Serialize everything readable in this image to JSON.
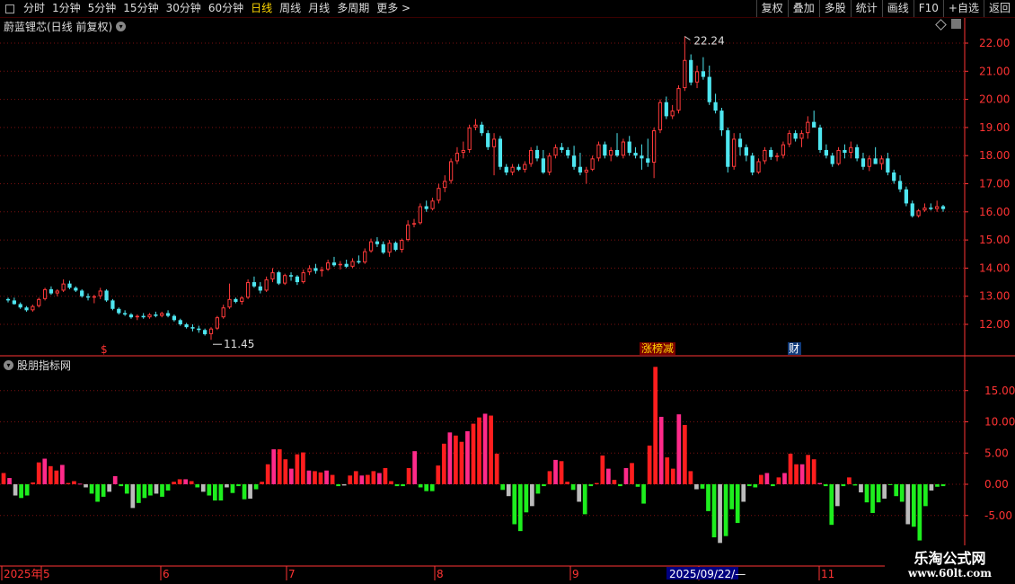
{
  "toolbar": {
    "periods": [
      "分时",
      "1分钟",
      "5分钟",
      "15分钟",
      "30分钟",
      "60分钟",
      "日线",
      "周线",
      "月线",
      "多周期",
      "更多 >"
    ],
    "active_period": "日线",
    "right_buttons": [
      "复权",
      "叠加",
      "多股",
      "统计",
      "画线",
      "F10",
      "+自选",
      "返回"
    ]
  },
  "chart": {
    "title": "蔚蓝锂芯(日线 前复权)",
    "high_label": "22.24",
    "low_label": "11.45",
    "price_axis": [
      "22.00",
      "21.00",
      "20.00",
      "19.00",
      "18.00",
      "17.00",
      "16.00",
      "15.00",
      "14.00",
      "13.00",
      "12.00"
    ],
    "markers": {
      "s": "$",
      "zbj": "涨榜减",
      "cai": "财"
    }
  },
  "indicator": {
    "title": "股朋指标网",
    "axis": [
      "15.00",
      "10.00",
      "5.00",
      "0.00",
      "-5.00"
    ]
  },
  "time_axis": {
    "labels": [
      "2025年",
      "5",
      "6",
      "7",
      "8",
      "9",
      "10",
      "11"
    ],
    "cursor_date": "2025/09/22/—"
  },
  "watermark": {
    "line1": "乐淘公式网",
    "line2": "www.60lt.com"
  },
  "colors": {
    "up": "#ff3a3a",
    "down": "#4ee6f0",
    "ind_red": "#ff1e1e",
    "ind_pink": "#ff2a8a",
    "ind_green": "#1eee1e",
    "ind_gray": "#bbbbbb",
    "axis": "#ff3333"
  },
  "chart_data": [
    {
      "type": "candlestick",
      "title": "蔚蓝锂芯(日线 前复权)",
      "ylim": [
        11.1,
        22.6
      ],
      "ohlc": [
        [
          12.9,
          12.95,
          12.78,
          12.85
        ],
        [
          12.85,
          12.95,
          12.7,
          12.72
        ],
        [
          12.72,
          12.78,
          12.55,
          12.6
        ],
        [
          12.6,
          12.65,
          12.45,
          12.5
        ],
        [
          12.5,
          12.7,
          12.45,
          12.65
        ],
        [
          12.65,
          12.95,
          12.6,
          12.9
        ],
        [
          12.9,
          13.3,
          12.85,
          13.25
        ],
        [
          13.25,
          13.35,
          13.05,
          13.1
        ],
        [
          13.1,
          13.25,
          13.0,
          13.2
        ],
        [
          13.2,
          13.6,
          13.15,
          13.45
        ],
        [
          13.45,
          13.55,
          13.25,
          13.3
        ],
        [
          13.3,
          13.35,
          13.15,
          13.2
        ],
        [
          13.2,
          13.25,
          12.95,
          13.0
        ],
        [
          13.0,
          13.1,
          12.85,
          12.95
        ],
        [
          12.95,
          13.05,
          12.75,
          13.0
        ],
        [
          13.0,
          13.3,
          12.9,
          13.2
        ],
        [
          13.2,
          13.25,
          12.8,
          12.85
        ],
        [
          12.85,
          12.9,
          12.5,
          12.55
        ],
        [
          12.55,
          12.6,
          12.35,
          12.4
        ],
        [
          12.4,
          12.5,
          12.3,
          12.35
        ],
        [
          12.35,
          12.4,
          12.2,
          12.25
        ],
        [
          12.25,
          12.35,
          12.15,
          12.3
        ],
        [
          12.3,
          12.4,
          12.2,
          12.25
        ],
        [
          12.25,
          12.4,
          12.2,
          12.35
        ],
        [
          12.35,
          12.45,
          12.25,
          12.3
        ],
        [
          12.3,
          12.45,
          12.25,
          12.4
        ],
        [
          12.4,
          12.5,
          12.25,
          12.3
        ],
        [
          12.3,
          12.35,
          12.1,
          12.15
        ],
        [
          12.15,
          12.2,
          11.95,
          12.0
        ],
        [
          12.0,
          12.05,
          11.85,
          11.9
        ],
        [
          11.9,
          12.0,
          11.75,
          11.85
        ],
        [
          11.85,
          11.95,
          11.7,
          11.8
        ],
        [
          11.8,
          11.85,
          11.6,
          11.65
        ],
        [
          11.65,
          11.9,
          11.45,
          11.85
        ],
        [
          11.85,
          12.3,
          11.8,
          12.25
        ],
        [
          12.25,
          12.7,
          12.2,
          12.6
        ],
        [
          12.6,
          13.45,
          12.55,
          12.9
        ],
        [
          12.9,
          12.95,
          12.75,
          12.8
        ],
        [
          12.8,
          13.0,
          12.7,
          12.95
        ],
        [
          12.95,
          13.6,
          12.9,
          13.5
        ],
        [
          13.5,
          13.7,
          13.3,
          13.35
        ],
        [
          13.35,
          13.5,
          13.1,
          13.2
        ],
        [
          13.2,
          13.7,
          13.15,
          13.6
        ],
        [
          13.6,
          14.0,
          13.5,
          13.85
        ],
        [
          13.85,
          13.9,
          13.4,
          13.45
        ],
        [
          13.45,
          13.8,
          13.4,
          13.75
        ],
        [
          13.75,
          13.85,
          13.55,
          13.7
        ],
        [
          13.7,
          13.75,
          13.4,
          13.5
        ],
        [
          13.5,
          13.95,
          13.45,
          13.85
        ],
        [
          13.85,
          14.1,
          13.75,
          14.0
        ],
        [
          14.0,
          14.15,
          13.8,
          13.9
        ],
        [
          13.9,
          14.05,
          13.7,
          13.95
        ],
        [
          13.95,
          14.3,
          13.9,
          14.2
        ],
        [
          14.2,
          14.4,
          14.05,
          14.1
        ],
        [
          14.1,
          14.25,
          13.95,
          14.15
        ],
        [
          14.15,
          14.3,
          14.0,
          14.05
        ],
        [
          14.05,
          14.35,
          14.0,
          14.25
        ],
        [
          14.25,
          14.45,
          14.15,
          14.2
        ],
        [
          14.2,
          14.7,
          14.15,
          14.6
        ],
        [
          14.6,
          15.05,
          14.55,
          14.95
        ],
        [
          14.95,
          15.1,
          14.75,
          14.85
        ],
        [
          14.85,
          14.95,
          14.5,
          14.55
        ],
        [
          14.55,
          15.0,
          14.4,
          14.9
        ],
        [
          14.9,
          14.95,
          14.6,
          14.65
        ],
        [
          14.65,
          15.05,
          14.55,
          15.0
        ],
        [
          15.0,
          15.7,
          14.95,
          15.55
        ],
        [
          15.55,
          15.75,
          15.45,
          15.6
        ],
        [
          15.6,
          16.3,
          15.55,
          16.2
        ],
        [
          16.2,
          16.4,
          16.0,
          16.1
        ],
        [
          16.1,
          16.5,
          16.05,
          16.4
        ],
        [
          16.4,
          17.0,
          16.3,
          16.85
        ],
        [
          16.85,
          17.3,
          16.7,
          17.1
        ],
        [
          17.1,
          17.9,
          17.0,
          17.8
        ],
        [
          17.8,
          18.3,
          17.7,
          18.1
        ],
        [
          18.1,
          18.5,
          17.9,
          18.2
        ],
        [
          18.2,
          19.1,
          18.1,
          19.0
        ],
        [
          19.0,
          19.3,
          18.9,
          19.1
        ],
        [
          19.1,
          19.2,
          18.7,
          18.8
        ],
        [
          18.8,
          18.9,
          18.2,
          18.3
        ],
        [
          18.3,
          18.8,
          17.3,
          18.6
        ],
        [
          18.6,
          18.7,
          17.5,
          17.6
        ],
        [
          17.6,
          17.7,
          17.3,
          17.4
        ],
        [
          17.4,
          17.7,
          17.3,
          17.6
        ],
        [
          17.6,
          17.7,
          17.45,
          17.5
        ],
        [
          17.5,
          17.8,
          17.4,
          17.7
        ],
        [
          17.7,
          18.3,
          17.6,
          18.2
        ],
        [
          18.2,
          18.35,
          17.8,
          17.9
        ],
        [
          17.9,
          18.2,
          17.35,
          17.4
        ],
        [
          17.4,
          18.1,
          17.3,
          18.0
        ],
        [
          18.0,
          18.4,
          17.9,
          18.3
        ],
        [
          18.3,
          18.45,
          18.1,
          18.2
        ],
        [
          18.2,
          18.3,
          17.9,
          18.0
        ],
        [
          18.0,
          18.35,
          17.5,
          17.6
        ],
        [
          17.6,
          18.1,
          17.3,
          17.4
        ],
        [
          17.4,
          17.6,
          17.0,
          17.5
        ],
        [
          17.5,
          18.0,
          17.45,
          17.9
        ],
        [
          17.9,
          18.5,
          17.8,
          18.4
        ],
        [
          18.4,
          18.5,
          17.9,
          18.0
        ],
        [
          18.0,
          18.3,
          17.8,
          18.2
        ],
        [
          18.2,
          18.8,
          17.95,
          18.0
        ],
        [
          18.0,
          18.6,
          17.9,
          18.5
        ],
        [
          18.5,
          18.7,
          18.0,
          18.1
        ],
        [
          18.1,
          18.3,
          17.9,
          18.0
        ],
        [
          18.0,
          18.4,
          17.5,
          17.9
        ],
        [
          17.9,
          18.6,
          17.6,
          17.75
        ],
        [
          17.75,
          19.0,
          17.2,
          18.9
        ],
        [
          18.9,
          20.0,
          18.8,
          19.9
        ],
        [
          19.9,
          20.1,
          19.3,
          19.4
        ],
        [
          19.4,
          19.8,
          19.3,
          19.6
        ],
        [
          19.6,
          20.5,
          19.5,
          20.4
        ],
        [
          20.4,
          22.24,
          20.3,
          21.4
        ],
        [
          21.4,
          21.6,
          20.5,
          20.6
        ],
        [
          20.6,
          21.2,
          20.4,
          21.0
        ],
        [
          21.0,
          21.5,
          20.7,
          20.8
        ],
        [
          20.8,
          21.2,
          19.8,
          19.9
        ],
        [
          19.9,
          20.2,
          19.5,
          19.6
        ],
        [
          19.6,
          19.7,
          18.7,
          18.9
        ],
        [
          18.9,
          19.0,
          17.4,
          17.6
        ],
        [
          17.6,
          18.8,
          17.5,
          18.6
        ],
        [
          18.6,
          18.8,
          18.0,
          18.3
        ],
        [
          18.3,
          18.4,
          17.8,
          18.0
        ],
        [
          18.0,
          18.1,
          17.3,
          17.4
        ],
        [
          17.4,
          17.9,
          17.35,
          17.8
        ],
        [
          17.8,
          18.3,
          17.7,
          18.2
        ],
        [
          18.2,
          18.3,
          17.85,
          17.95
        ],
        [
          17.95,
          18.1,
          17.8,
          18.0
        ],
        [
          18.0,
          18.5,
          17.9,
          18.4
        ],
        [
          18.4,
          18.9,
          18.3,
          18.8
        ],
        [
          18.8,
          18.9,
          18.5,
          18.6
        ],
        [
          18.6,
          18.9,
          18.3,
          18.8
        ],
        [
          18.8,
          19.4,
          18.6,
          19.2
        ],
        [
          19.2,
          19.6,
          19.0,
          19.0
        ],
        [
          19.0,
          19.1,
          18.1,
          18.2
        ],
        [
          18.2,
          18.4,
          17.9,
          18.0
        ],
        [
          18.0,
          18.1,
          17.6,
          17.7
        ],
        [
          17.7,
          18.3,
          17.65,
          18.2
        ],
        [
          18.2,
          18.4,
          17.9,
          18.1
        ],
        [
          18.1,
          18.5,
          17.9,
          18.3
        ],
        [
          18.3,
          18.4,
          17.8,
          17.9
        ],
        [
          17.9,
          18.1,
          17.5,
          17.6
        ],
        [
          17.6,
          18.0,
          17.45,
          17.9
        ],
        [
          17.9,
          18.3,
          17.7,
          17.7
        ],
        [
          17.7,
          18.0,
          17.5,
          17.9
        ],
        [
          17.9,
          18.1,
          17.3,
          17.4
        ],
        [
          17.4,
          17.5,
          17.0,
          17.1
        ],
        [
          17.1,
          17.3,
          16.7,
          16.8
        ],
        [
          16.8,
          16.9,
          16.2,
          16.3
        ],
        [
          16.3,
          16.4,
          15.8,
          15.85
        ],
        [
          15.85,
          16.1,
          15.8,
          16.05
        ],
        [
          16.05,
          16.3,
          16.0,
          16.15
        ],
        [
          16.15,
          16.3,
          16.05,
          16.1
        ],
        [
          16.1,
          16.4,
          16.0,
          16.2
        ],
        [
          16.2,
          16.25,
          16.0,
          16.1
        ]
      ]
    },
    {
      "type": "bar",
      "title": "股朋指标网",
      "ylim": [
        -9.8,
        19.5
      ],
      "values": [
        1.8,
        1.0,
        -1.8,
        -2.2,
        -1.8,
        0.3,
        3.5,
        4.1,
        2.9,
        2.2,
        3.1,
        0.2,
        0.5,
        0.1,
        -0.5,
        -1.5,
        -2.8,
        -2.0,
        -1.2,
        1.3,
        -0.3,
        -1.5,
        -3.8,
        -3.0,
        -2.2,
        -1.8,
        -1.5,
        -2.0,
        -1.0,
        0.4,
        0.8,
        0.8,
        0.5,
        -0.5,
        -1.2,
        -1.8,
        -2.6,
        -2.6,
        -0.5,
        -1.4,
        -0.3,
        -2.4,
        -2.3,
        -0.8,
        0.4,
        3.2,
        5.6,
        5.6,
        4.0,
        2.5,
        4.8,
        5.1,
        2.2,
        2.1,
        1.9,
        2.2,
        1.5,
        -0.3,
        -0.2,
        1.4,
        2.1,
        1.4,
        1.5,
        2.1,
        1.8,
        2.6,
        0.5,
        -0.3,
        -0.3,
        2.6,
        5.3,
        -0.5,
        -1.1,
        -1.1,
        3.0,
        6.5,
        8.3,
        7.8,
        6.8,
        8.5,
        9.7,
        10.7,
        11.3,
        11.0,
        4.9,
        -0.9,
        -1.9,
        -6.4,
        -7.5,
        -4.5,
        -3.5,
        -1.5,
        -0.3,
        2.1,
        3.9,
        3.7,
        0.4,
        -0.9,
        -2.8,
        -4.8,
        -0.3,
        0.2,
        4.6,
        2.5,
        0.7,
        -0.3,
        2.6,
        3.4,
        -0.4,
        -3.1,
        6.2,
        18.8,
        10.8,
        4.3,
        2.5,
        11.2,
        9.5,
        2.1,
        -0.8,
        -0.7,
        -4.3,
        -8.5,
        -9.4,
        -8.3,
        -4.0,
        -6.2,
        -2.8,
        -0.3,
        -0.5,
        1.5,
        1.8,
        -0.3,
        1.1,
        1.8,
        4.9,
        3.2,
        3.2,
        4.7,
        4.0,
        0.2,
        -0.3,
        -6.5,
        -3.5,
        -0.3,
        1.1,
        -0.2,
        -1.3,
        -2.9,
        -4.6,
        -2.9,
        -2.3,
        -0.1,
        -1.9,
        -2.8,
        -6.4,
        -6.8,
        -9.0,
        -3.5,
        -1.0,
        -0.4,
        -0.3
      ],
      "axis_ticks": [
        15,
        10,
        5,
        0,
        -5
      ]
    }
  ]
}
